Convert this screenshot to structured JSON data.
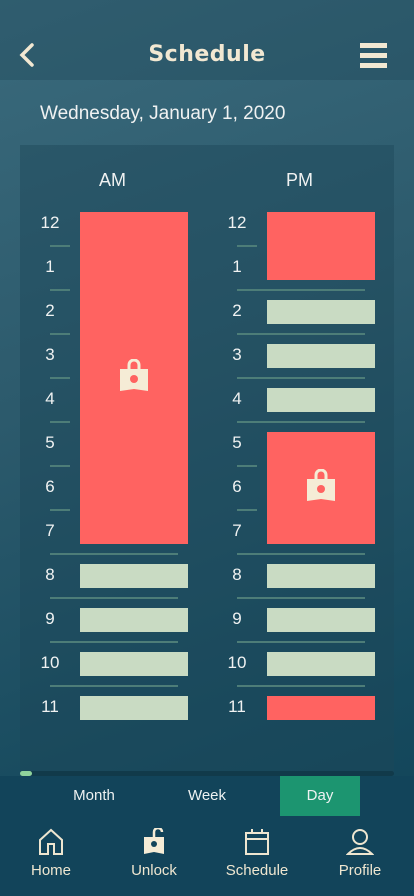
{
  "header": {
    "title": "Schedule",
    "back_icon": "chevron-left-icon",
    "menu_icon": "hamburger-menu-icon"
  },
  "date": "Wednesday, January 1, 2020",
  "colors": {
    "booked": "#ff6361",
    "available": "#c9dbc3",
    "accent": "#1c9570",
    "icon": "#f5ecd6"
  },
  "schedule": {
    "am": {
      "label": "AM",
      "hours": [
        "12",
        "1",
        "2",
        "3",
        "4",
        "5",
        "6",
        "7",
        "8",
        "9",
        "10",
        "11"
      ],
      "blocks": [
        {
          "start": 0,
          "end": 7,
          "status": "booked",
          "icon": "lock-icon"
        },
        {
          "start": 8,
          "end": 8,
          "status": "available"
        },
        {
          "start": 9,
          "end": 9,
          "status": "available"
        },
        {
          "start": 10,
          "end": 10,
          "status": "available"
        },
        {
          "start": 11,
          "end": 11,
          "status": "available"
        }
      ]
    },
    "pm": {
      "label": "PM",
      "hours": [
        "12",
        "1",
        "2",
        "3",
        "4",
        "5",
        "6",
        "7",
        "8",
        "9",
        "10",
        "11"
      ],
      "blocks": [
        {
          "start": 0,
          "end": 1,
          "status": "booked"
        },
        {
          "start": 2,
          "end": 2,
          "status": "available"
        },
        {
          "start": 3,
          "end": 3,
          "status": "available"
        },
        {
          "start": 4,
          "end": 4,
          "status": "available"
        },
        {
          "start": 5,
          "end": 7,
          "status": "booked",
          "icon": "lock-icon"
        },
        {
          "start": 8,
          "end": 8,
          "status": "available"
        },
        {
          "start": 9,
          "end": 9,
          "status": "available"
        },
        {
          "start": 10,
          "end": 10,
          "status": "available"
        },
        {
          "start": 11,
          "end": 11,
          "status": "booked"
        }
      ]
    }
  },
  "view_tabs": [
    {
      "label": "Month"
    },
    {
      "label": "Week"
    },
    {
      "label": "Day",
      "active": true
    }
  ],
  "nav": [
    {
      "label": "Home",
      "icon": "home-icon"
    },
    {
      "label": "Unlock",
      "icon": "unlock-icon"
    },
    {
      "label": "Schedule",
      "icon": "calendar-icon"
    },
    {
      "label": "Profile",
      "icon": "profile-icon"
    }
  ]
}
